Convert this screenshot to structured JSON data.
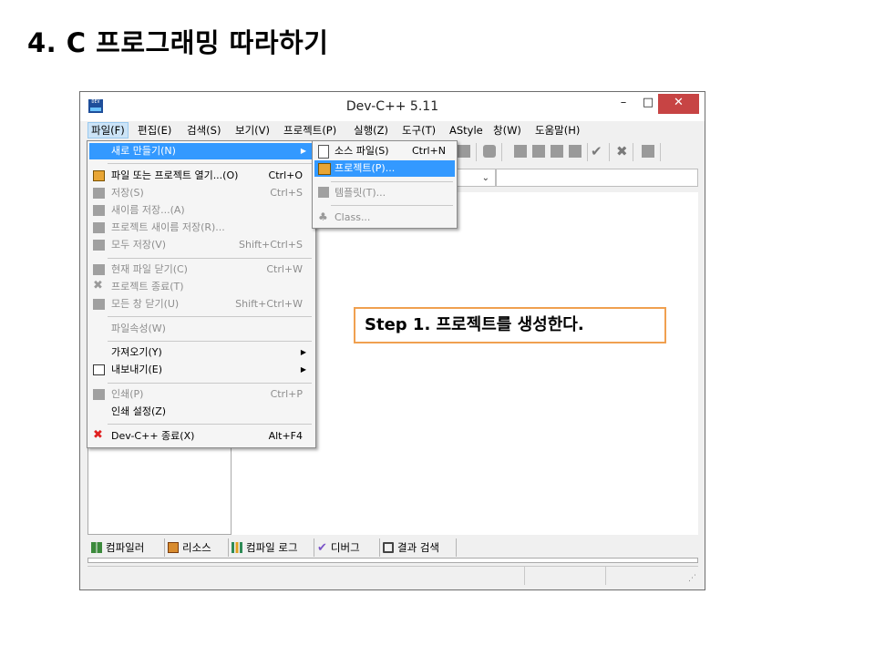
{
  "slide": {
    "title": "4. C 프로그래밍 따라하기"
  },
  "window": {
    "title": "Dev-C++ 5.11",
    "controls": {
      "minimize": "–",
      "maximize": "□",
      "close": "✕"
    }
  },
  "menubar": [
    {
      "label": "파일(F)"
    },
    {
      "label": "편집(E)"
    },
    {
      "label": "검색(S)"
    },
    {
      "label": "보기(V)"
    },
    {
      "label": "프로젝트(P)"
    },
    {
      "label": "실행(Z)"
    },
    {
      "label": "도구(T)"
    },
    {
      "label": "AStyle"
    },
    {
      "label": "창(W)"
    },
    {
      "label": "도움말(H)"
    }
  ],
  "file_menu": {
    "items": [
      {
        "label": "새로 만들기(N)",
        "shortcut": "",
        "submenu": true,
        "state": "highlighted"
      },
      {
        "label": "파일 또는 프로젝트 열기...(O)",
        "shortcut": "Ctrl+O",
        "icon": "open-folder-icon",
        "state": "enabled"
      },
      {
        "label": "저장(S)",
        "shortcut": "Ctrl+S",
        "icon": "save-icon",
        "state": "disabled"
      },
      {
        "label": "새이름 저장...(A)",
        "shortcut": "",
        "icon": "save-as-icon",
        "state": "disabled"
      },
      {
        "label": "프로젝트 새이름 저장(R)...",
        "shortcut": "",
        "icon": "save-project-as-icon",
        "state": "disabled"
      },
      {
        "label": "모두 저장(V)",
        "shortcut": "Shift+Ctrl+S",
        "icon": "save-all-icon",
        "state": "disabled"
      },
      {
        "label": "현재 파일 닫기(C)",
        "shortcut": "Ctrl+W",
        "icon": "close-file-icon",
        "state": "disabled"
      },
      {
        "label": "프로젝트 종료(T)",
        "shortcut": "",
        "icon": "close-project-icon",
        "state": "disabled"
      },
      {
        "label": "모든 창 닫기(U)",
        "shortcut": "Shift+Ctrl+W",
        "icon": "close-all-icon",
        "state": "disabled"
      },
      {
        "label": "파일속성(W)",
        "shortcut": "",
        "state": "disabled"
      },
      {
        "label": "가져오기(Y)",
        "shortcut": "",
        "submenu": true,
        "state": "enabled"
      },
      {
        "label": "내보내기(E)",
        "shortcut": "",
        "submenu": true,
        "icon": "export-icon",
        "state": "enabled"
      },
      {
        "label": "인쇄(P)",
        "shortcut": "Ctrl+P",
        "icon": "print-icon",
        "state": "disabled"
      },
      {
        "label": "인쇄 설정(Z)",
        "shortcut": "",
        "state": "enabled"
      },
      {
        "label": "Dev-C++ 종료(X)",
        "shortcut": "Alt+F4",
        "icon": "exit-icon",
        "state": "enabled"
      }
    ]
  },
  "new_submenu": {
    "items": [
      {
        "label": "소스 파일(S)",
        "shortcut": "Ctrl+N",
        "icon": "source-file-icon",
        "state": "enabled"
      },
      {
        "label": "프로젝트(P)...",
        "shortcut": "",
        "icon": "project-icon",
        "state": "highlighted"
      },
      {
        "label": "템플릿(T)...",
        "shortcut": "",
        "icon": "template-icon",
        "state": "disabled"
      },
      {
        "label": "Class...",
        "shortcut": "",
        "icon": "class-icon",
        "state": "disabled"
      }
    ]
  },
  "bottom_tabs": [
    {
      "label": "컴파일러",
      "icon": "compiler-grid-icon"
    },
    {
      "label": "리소스",
      "icon": "resources-icon"
    },
    {
      "label": "컴파일 로그",
      "icon": "compile-log-chart-icon"
    },
    {
      "label": "디버그",
      "icon": "debug-check-icon"
    },
    {
      "label": "결과 검색",
      "icon": "find-results-icon"
    }
  ],
  "combo": {
    "arrow": "⌄"
  },
  "callout": {
    "text": "Step 1. 프로젝트를 생성한다."
  },
  "colors": {
    "highlight": "#3399ff",
    "close_button": "#c74444",
    "callout_border": "#f0a050"
  }
}
